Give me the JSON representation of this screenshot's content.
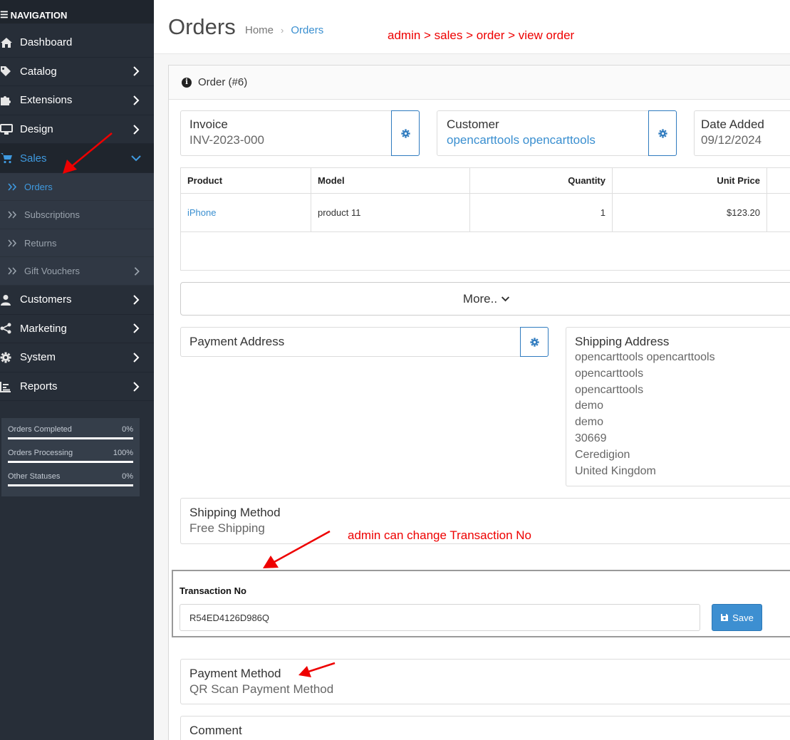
{
  "sidebar": {
    "header": "NAVIGATION",
    "items": [
      {
        "label": "Dashboard"
      },
      {
        "label": "Catalog"
      },
      {
        "label": "Extensions"
      },
      {
        "label": "Design"
      },
      {
        "label": "Sales"
      },
      {
        "label": "Customers"
      },
      {
        "label": "Marketing"
      },
      {
        "label": "System"
      },
      {
        "label": "Reports"
      }
    ],
    "sales_sub": [
      {
        "label": "Orders"
      },
      {
        "label": "Subscriptions"
      },
      {
        "label": "Returns"
      },
      {
        "label": "Gift Vouchers"
      }
    ],
    "stats": [
      {
        "label": "Orders Completed",
        "value": "0%",
        "fraction": 0.0
      },
      {
        "label": "Orders Processing",
        "value": "100%",
        "fraction": 1.0
      },
      {
        "label": "Other Statuses",
        "value": "0%",
        "fraction": 0.0
      }
    ]
  },
  "header": {
    "title": "Orders",
    "breadcrumb_home": "Home",
    "breadcrumb_current": "Orders"
  },
  "annotations": {
    "top": "admin > sales > order > view order",
    "transaction": "admin can change Transaction No"
  },
  "order": {
    "heading": "Order (#6)",
    "invoice_label": "Invoice",
    "invoice_value": "INV-2023-000",
    "customer_label": "Customer",
    "customer_value": "opencarttools opencarttools",
    "date_label": "Date Added",
    "date_value": "09/12/2024",
    "table": {
      "headers": [
        "Product",
        "Model",
        "Quantity",
        "Unit Price"
      ],
      "rows": [
        {
          "product": "iPhone",
          "model": "product 11",
          "quantity": "1",
          "unit_price": "$123.20"
        }
      ]
    },
    "more_label": "More..",
    "payment_address_label": "Payment Address",
    "shipping_address_label": "Shipping Address",
    "shipping_address_lines": [
      "opencarttools opencarttools",
      "opencarttools",
      "opencarttools",
      "demo",
      "demo",
      "30669",
      "Ceredigion",
      "United Kingdom"
    ],
    "shipping_method_label": "Shipping Method",
    "shipping_method_value": "Free Shipping",
    "transaction_label": "Transaction No",
    "transaction_value": "R54ED4126D986Q",
    "save_label": "Save",
    "payment_method_label": "Payment Method",
    "payment_method_value": "QR Scan Payment Method",
    "comment_label": "Comment"
  },
  "colors": {
    "sidebar_bg": "#272e38",
    "accent": "#3a8fd0",
    "annotation": "#ee0000"
  }
}
